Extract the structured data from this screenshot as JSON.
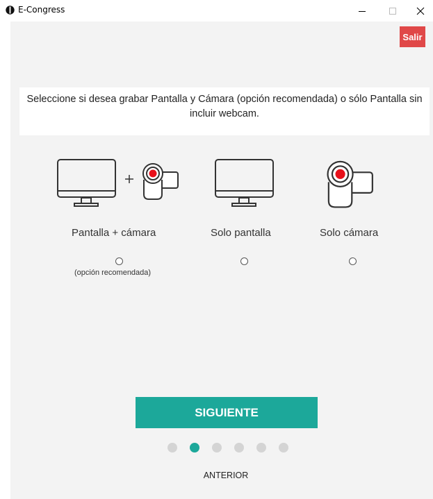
{
  "window": {
    "title": "E-Congress",
    "controls": [
      "minimize",
      "maximize",
      "close"
    ]
  },
  "header": {
    "exit_label": "Salir",
    "exit_color": "#e04848"
  },
  "instruction": "Seleccione si desea grabar Pantalla y Cámara (opción recomendada) o sólo Pantalla sin incluir webcam.",
  "options": [
    {
      "label": "Pantalla + cámara",
      "note": "(opción recomendada)",
      "selected": false,
      "icons": [
        "monitor-icon",
        "plus-icon",
        "camera-icon"
      ]
    },
    {
      "label": "Solo pantalla",
      "selected": false,
      "icons": [
        "monitor-icon"
      ]
    },
    {
      "label": "Solo cámara",
      "selected": false,
      "icons": [
        "camera-icon"
      ]
    }
  ],
  "navigation": {
    "next_label": "SIGUIENTE",
    "prev_label": "ANTERIOR",
    "step_current": 2,
    "step_total": 6
  },
  "colors": {
    "accent": "#1ca89a",
    "danger": "#e04848",
    "background": "#f3f3f3",
    "record_red": "#e8101a"
  }
}
